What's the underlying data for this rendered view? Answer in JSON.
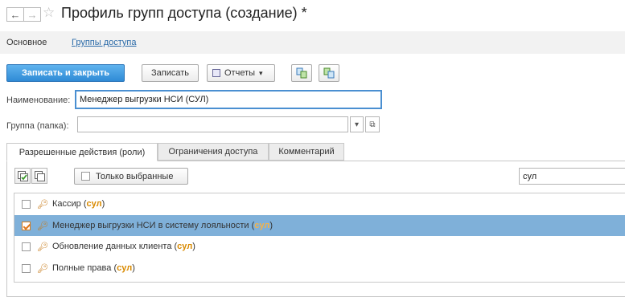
{
  "header": {
    "back_glyph": "←",
    "forward_glyph": "→",
    "star_glyph": "☆",
    "title": "Профиль групп доступа (создание) *"
  },
  "nav_tabs": {
    "main": "Основное",
    "groups_link": "Группы доступа"
  },
  "toolbar": {
    "save_close": "Записать и закрыть",
    "save": "Записать",
    "reports": "Отчеты",
    "reports_arrow": "▾"
  },
  "form": {
    "name_label": "Наименование:",
    "name_value": "Менеджер выгрузки НСИ (СУЛ)",
    "group_label": "Группа (папка):",
    "group_value": "",
    "dropdown_glyph": "▾",
    "open_glyph": "⧉"
  },
  "tabs": [
    {
      "label": "Разрешенные действия (роли)"
    },
    {
      "label": "Ограничения доступа"
    },
    {
      "label": "Комментарий"
    }
  ],
  "roles_panel": {
    "only_selected_label": "Только выбранные",
    "search_value": "сул"
  },
  "roles": [
    {
      "before": "Кассир (",
      "match": "сул",
      "after": ")",
      "checked": false
    },
    {
      "before": "Менеджер выгрузки НСИ в систему лояльности (",
      "match": "сул",
      "after": ")",
      "checked": true
    },
    {
      "before": "Обновление данных клиента (",
      "match": "сул",
      "after": ")",
      "checked": false
    },
    {
      "before": "Полные права (",
      "match": "сул",
      "after": ")",
      "checked": false
    }
  ],
  "colors": {
    "primary_button": "#3a9be3",
    "selected_row": "#7fb0d9",
    "search_highlight": "#d98a00",
    "link": "#2a6aa8"
  }
}
